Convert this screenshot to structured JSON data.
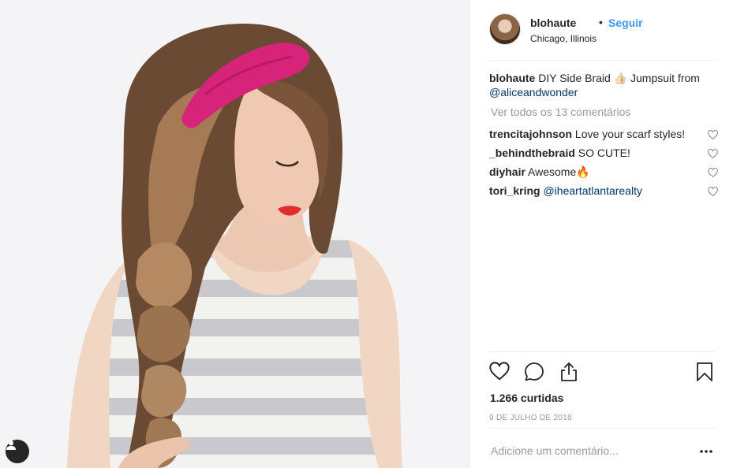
{
  "post": {
    "photo": {
      "subject": "woman with pink headband and side braid",
      "tag_icon": "user-tag-icon"
    },
    "header": {
      "username": "blohaute",
      "separator": "•",
      "follow_label": "Seguir",
      "location": "Chicago, Illinois"
    },
    "caption": {
      "username": "blohaute",
      "text": "DIY Side Braid 👍🏻 Jumpsuit from",
      "mention": "@aliceandwonder"
    },
    "view_all_label": "Ver todos os 13 comentários",
    "comments": [
      {
        "user": "trencitajohnson",
        "text": "Love your scarf styles!",
        "mention": ""
      },
      {
        "user": "_behindthebraid",
        "text": "SO CUTE!",
        "mention": ""
      },
      {
        "user": "diyhair",
        "text": "Awesome🔥",
        "mention": ""
      },
      {
        "user": "tori_kring",
        "text": "",
        "mention": "@iheartatlantarealty"
      }
    ],
    "actions": {
      "like_icon": "heart-icon",
      "comment_icon": "comment-bubble-icon",
      "share_icon": "share-icon",
      "save_icon": "bookmark-icon"
    },
    "likes_label": "1.266 curtidas",
    "date_label": "9 DE JULHO DE 2018",
    "add_comment_placeholder": "Adicione um comentário...",
    "more_icon": "more-options-icon"
  },
  "colors": {
    "link": "#3897f0",
    "mention": "#003569",
    "muted": "#999999",
    "text": "#262626",
    "divider": "#efefef",
    "headband": "#d8237a"
  }
}
